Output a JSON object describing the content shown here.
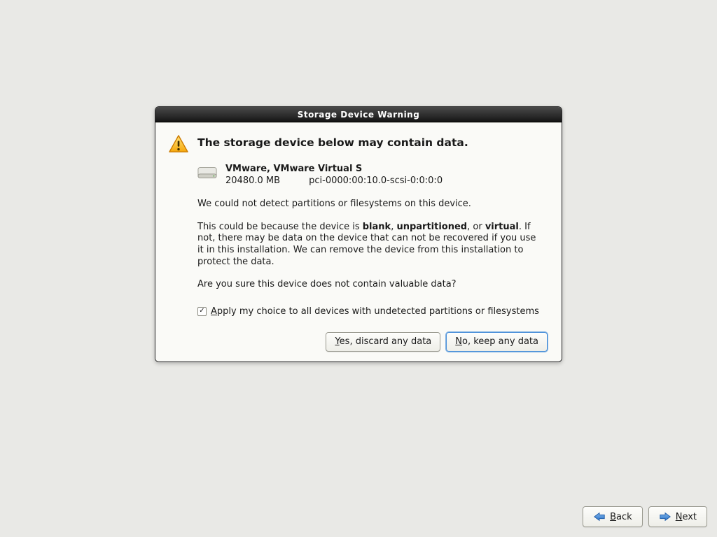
{
  "dialog": {
    "title": "Storage Device Warning",
    "heading": "The storage device below may contain data.",
    "device": {
      "name": "VMware, VMware Virtual S",
      "size": "20480.0 MB",
      "path": "pci-0000:00:10.0-scsi-0:0:0:0"
    },
    "para1": "We could not detect partitions or filesystems on this device.",
    "para2_pre": "This could be because the device is ",
    "para2_b1": "blank",
    "para2_sep1": ", ",
    "para2_b2": "unpartitioned",
    "para2_sep2": ", or ",
    "para2_b3": "virtual",
    "para2_post": ". If not, there may be data on the device that can not be recovered if you use it in this installation. We can remove the device from this installation to protect the data.",
    "para3": "Are you sure this device does not contain valuable data?",
    "checkbox": {
      "checked": true,
      "label_pre": "A",
      "label_rest": "pply my choice to all devices with undetected partitions or filesystems"
    },
    "buttons": {
      "yes_pre": "Y",
      "yes_rest": "es, discard any data",
      "no_pre": "N",
      "no_rest": "o, keep any data"
    }
  },
  "nav": {
    "back_pre": "B",
    "back_rest": "ack",
    "next_pre": "N",
    "next_rest": "ext"
  }
}
